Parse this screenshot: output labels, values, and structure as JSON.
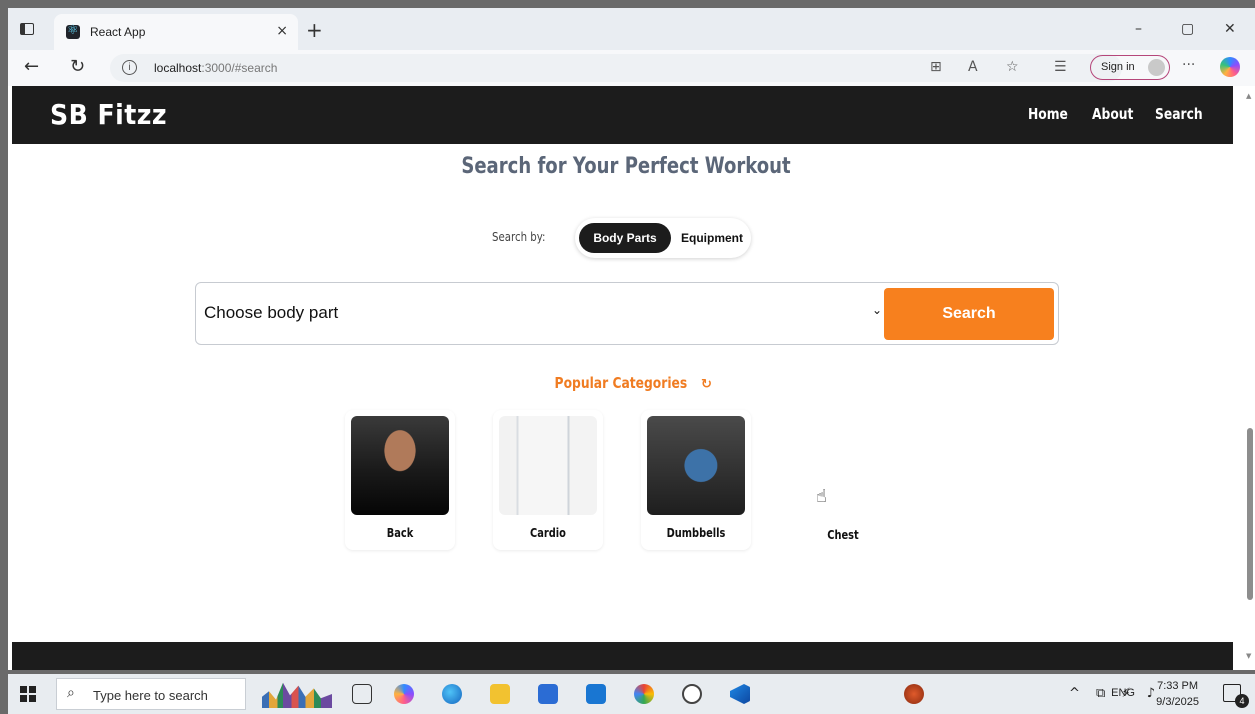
{
  "browser": {
    "tab_title": "React App",
    "tab_close": "×",
    "new_tab": "+",
    "url_host": "localhost",
    "url_path": ":3000/#search",
    "sign_in_label": "Sign in",
    "more": "···",
    "minimize": "–",
    "restore": "▢",
    "close": "✕"
  },
  "app": {
    "brand": "SB Fitzz",
    "nav": [
      "Home",
      "About",
      "Search"
    ],
    "heading": "Search for Your Perfect Workout",
    "search_by_label": "Search by:",
    "toggle": {
      "body_parts": "Body Parts",
      "equipment": "Equipment",
      "active": "Body Parts"
    },
    "select_value": "Choose body part",
    "search_button": "Search",
    "popular_title": "Popular Categories",
    "categories": [
      {
        "label": "Back",
        "icon": "back-muscle-photo"
      },
      {
        "label": "Cardio",
        "icon": "cardio-photo"
      },
      {
        "label": "Dumbbells",
        "icon": "dumbbells-photo"
      },
      {
        "label": "Chest",
        "icon": "chest-photo"
      }
    ]
  },
  "taskbar": {
    "search_placeholder": "Type here to search",
    "lang": "ENG",
    "time": "7:33 PM",
    "date": "9/3/2025",
    "notification_count": "4"
  },
  "colors": {
    "accent": "#f7801e",
    "navbar": "#1c1c1c",
    "heading": "#5b6678"
  }
}
